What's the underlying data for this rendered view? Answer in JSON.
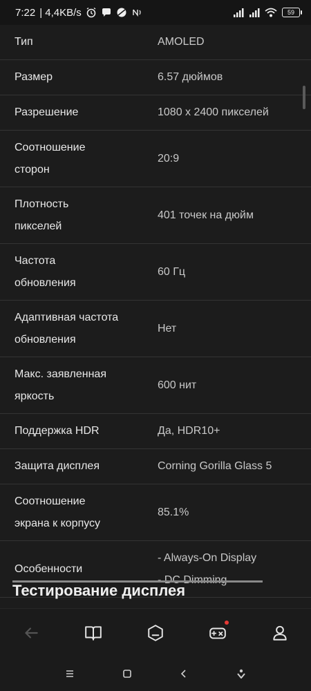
{
  "status_bar": {
    "time": "7:22",
    "speed": "| 4,4KB/s",
    "battery": "59"
  },
  "specs": [
    {
      "label_lines": [
        "Тип"
      ],
      "value_lines": [
        "AMOLED"
      ]
    },
    {
      "label_lines": [
        "Размер"
      ],
      "value_lines": [
        "6.57 дюймов"
      ]
    },
    {
      "label_lines": [
        "Разрешение"
      ],
      "value_lines": [
        "1080 x 2400 пикселей"
      ]
    },
    {
      "label_lines": [
        "Соотношение",
        "сторон"
      ],
      "value_lines": [
        "20:9"
      ]
    },
    {
      "label_lines": [
        "Плотность",
        "пикселей"
      ],
      "value_lines": [
        "401 точек на дюйм"
      ]
    },
    {
      "label_lines": [
        "Частота",
        "обновления"
      ],
      "value_lines": [
        "60 Гц"
      ]
    },
    {
      "label_lines": [
        "Адаптивная частота",
        "обновления"
      ],
      "value_lines": [
        "Нет"
      ]
    },
    {
      "label_lines": [
        "Макс. заявленная",
        "яркость"
      ],
      "value_lines": [
        "600 нит"
      ]
    },
    {
      "label_lines": [
        "Поддержка HDR"
      ],
      "value_lines": [
        "Да, HDR10+"
      ]
    },
    {
      "label_lines": [
        "Защита дисплея"
      ],
      "value_lines": [
        "Corning Gorilla Glass 5"
      ]
    },
    {
      "label_lines": [
        "Соотношение",
        "экрана к корпусу"
      ],
      "value_lines": [
        "85.1%"
      ]
    },
    {
      "label_lines": [
        "Особенности"
      ],
      "value_lines": [
        "- Always-On Display",
        "- DC Dimming"
      ]
    }
  ],
  "next_section_title": "Тестирование дисплея",
  "bottom_nav": {
    "items": [
      {
        "name": "back",
        "icon": "arrow-left-icon"
      },
      {
        "name": "catalog",
        "icon": "book-icon"
      },
      {
        "name": "compare",
        "icon": "box-icon"
      },
      {
        "name": "games",
        "icon": "gamepad-icon"
      },
      {
        "name": "profile",
        "icon": "user-icon"
      }
    ]
  },
  "colors": {
    "background": "#1c1c1c",
    "divider": "#343434",
    "notification_dot": "#e53935"
  }
}
